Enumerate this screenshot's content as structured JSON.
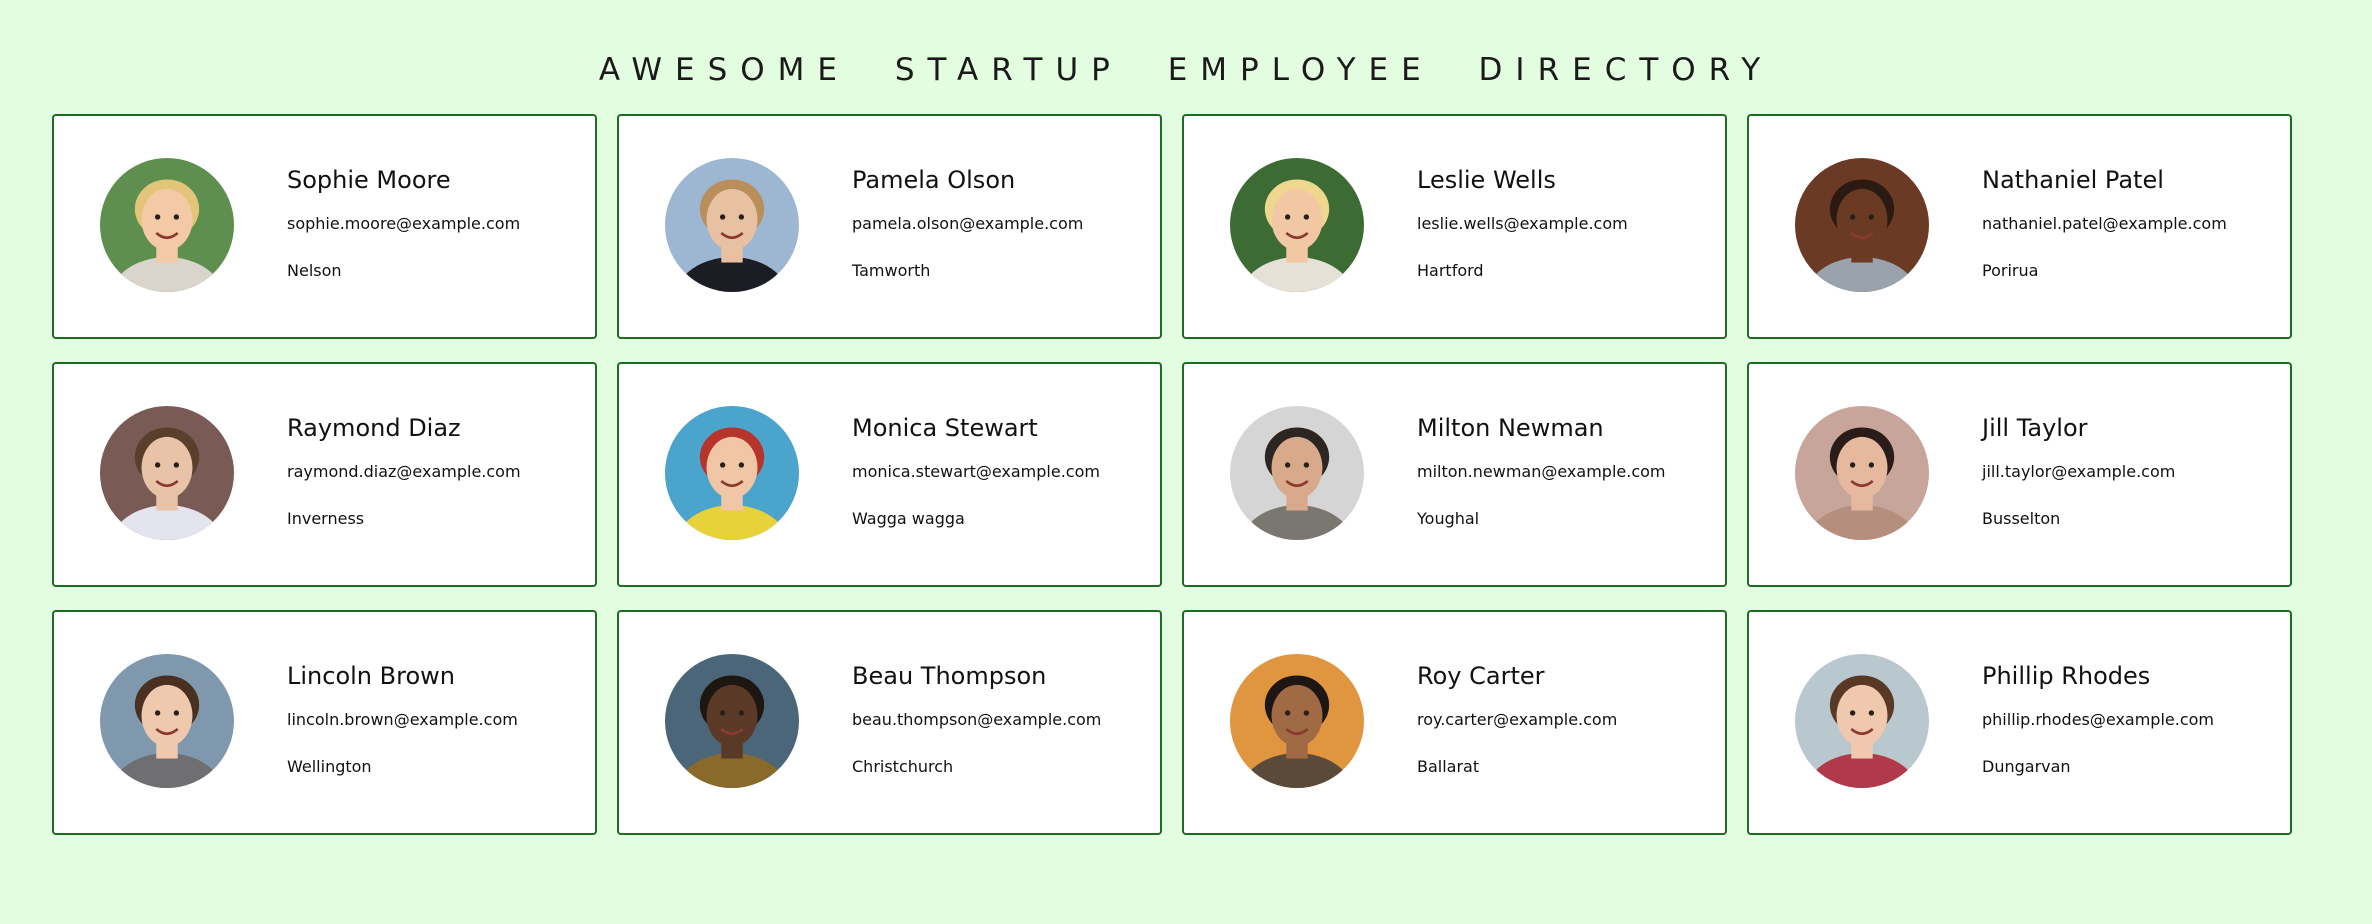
{
  "header": {
    "title": "AWESOME STARTUP EMPLOYEE DIRECTORY"
  },
  "colors": {
    "background": "#e3fde0",
    "card_border": "#1f6b24"
  },
  "employees": [
    {
      "name": "Sophie Moore",
      "email": "sophie.moore@example.com",
      "city": "Nelson",
      "avatar": {
        "bg": "#5f8f4e",
        "skin": "#f3c9a6",
        "hair": "#e2c47a",
        "shirt": "#d9d4cc"
      }
    },
    {
      "name": "Pamela Olson",
      "email": "pamela.olson@example.com",
      "city": "Tamworth",
      "avatar": {
        "bg": "#9db7d2",
        "skin": "#e8c0a2",
        "hair": "#b88e5b",
        "shirt": "#1c1c24"
      }
    },
    {
      "name": "Leslie Wells",
      "email": "leslie.wells@example.com",
      "city": "Hartford",
      "avatar": {
        "bg": "#3d6b34",
        "skin": "#f2c8a4",
        "hair": "#f0d790",
        "shirt": "#e6e1d7"
      }
    },
    {
      "name": "Nathaniel Patel",
      "email": "nathaniel.patel@example.com",
      "city": "Porirua",
      "avatar": {
        "bg": "#6b3a24",
        "skin": "#6a3a22",
        "hair": "#2a1a12",
        "shirt": "#9aa3ab"
      }
    },
    {
      "name": "Raymond Diaz",
      "email": "raymond.diaz@example.com",
      "city": "Inverness",
      "avatar": {
        "bg": "#7a5a54",
        "skin": "#e9c3a8",
        "hair": "#5a3f2c",
        "shirt": "#e4e4ee"
      }
    },
    {
      "name": "Monica Stewart",
      "email": "monica.stewart@example.com",
      "city": "Wagga wagga",
      "avatar": {
        "bg": "#4aa4cc",
        "skin": "#f0c6a6",
        "hair": "#b6342c",
        "shirt": "#e7d23a"
      }
    },
    {
      "name": "Milton Newman",
      "email": "milton.newman@example.com",
      "city": "Youghal",
      "avatar": {
        "bg": "#d5d5d5",
        "skin": "#d8a98a",
        "hair": "#2c2622",
        "shirt": "#7a7670"
      }
    },
    {
      "name": "Jill Taylor",
      "email": "jill.taylor@example.com",
      "city": "Busselton",
      "avatar": {
        "bg": "#c7a59a",
        "skin": "#e6b99e",
        "hair": "#2a1c18",
        "shirt": "#b58e7e"
      }
    },
    {
      "name": "Lincoln Brown",
      "email": "lincoln.brown@example.com",
      "city": "Wellington",
      "avatar": {
        "bg": "#7f98ad",
        "skin": "#efc9ad",
        "hair": "#4a3020",
        "shirt": "#6f6f72"
      }
    },
    {
      "name": "Beau Thompson",
      "email": "beau.thompson@example.com",
      "city": "Christchurch",
      "avatar": {
        "bg": "#4a6678",
        "skin": "#5a3a26",
        "hair": "#1e1610",
        "shirt": "#8a6a2a"
      }
    },
    {
      "name": "Roy Carter",
      "email": "roy.carter@example.com",
      "city": "Ballarat",
      "avatar": {
        "bg": "#e0953f",
        "skin": "#a06a44",
        "hair": "#1e1612",
        "shirt": "#5a4a3a"
      }
    },
    {
      "name": "Phillip Rhodes",
      "email": "phillip.rhodes@example.com",
      "city": "Dungarvan",
      "avatar": {
        "bg": "#b9c7cf",
        "skin": "#f0c8ad",
        "hair": "#5a3826",
        "shirt": "#b03a4a"
      }
    }
  ]
}
